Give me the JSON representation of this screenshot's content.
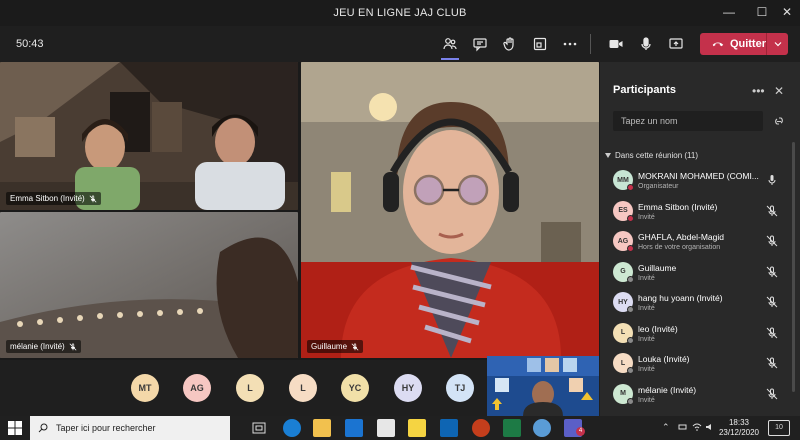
{
  "window": {
    "title": "JEU EN LIGNE JAJ CLUB",
    "minimize_glyph": "—",
    "maximize_glyph": "☐",
    "close_glyph": "✕"
  },
  "toolbar": {
    "timer": "50:43",
    "leave_label": "Quitter",
    "icons": [
      "people-icon",
      "chat-icon",
      "raise-hand-icon",
      "breakout-icon",
      "more-icon",
      "camera-icon",
      "microphone-icon",
      "share-screen-icon",
      "phone-icon"
    ]
  },
  "stage": {
    "tiles": [
      {
        "label": "Emma Sitbon (Invité)"
      },
      {
        "label": "mélanie (Invité)"
      },
      {
        "label": "Guillaume"
      }
    ],
    "avatars": [
      {
        "initials": "MT",
        "color": "#f4d8a9"
      },
      {
        "initials": "AG",
        "color": "#f6c7c2"
      },
      {
        "initials": "L",
        "color": "#f3dfb5"
      },
      {
        "initials": "L",
        "color": "#f6dcc4"
      },
      {
        "initials": "YC",
        "color": "#f1e0a8"
      },
      {
        "initials": "HY",
        "color": "#dcdcf2"
      },
      {
        "initials": "TJ",
        "color": "#d3e3f6"
      }
    ]
  },
  "panel": {
    "title": "Participants",
    "more_glyph": "•••",
    "close_glyph": "✕",
    "search_placeholder": "Tapez un nom",
    "section_label": "Dans cette réunion (11)",
    "participants": [
      {
        "initials": "MM",
        "name": "MOKRANI MOHAMED (COMI...",
        "role": "Organisateur",
        "avatar_color": "#c7e5d4",
        "status_color": "#c4314b",
        "mic": "on"
      },
      {
        "initials": "ES",
        "name": "Emma Sitbon (Invité)",
        "role": "Invité",
        "avatar_color": "#f6c7c2",
        "status_color": "#c4314b",
        "mic": "off"
      },
      {
        "initials": "AG",
        "name": "GHAFLA, Abdel-Magid",
        "role": "Hors de votre organisation",
        "avatar_color": "#f6c7c2",
        "status_color": "#c4314b",
        "mic": "off"
      },
      {
        "initials": "G",
        "name": "Guillaume",
        "role": "Invité",
        "avatar_color": "#cde8d2",
        "status_color": "#8a8a8a",
        "mic": "off"
      },
      {
        "initials": "HY",
        "name": "hang hu yoann (Invité)",
        "role": "Invité",
        "avatar_color": "#dcdcf2",
        "status_color": "#8a8a8a",
        "mic": "off"
      },
      {
        "initials": "L",
        "name": "leo (Invité)",
        "role": "Invité",
        "avatar_color": "#f3dfb5",
        "status_color": "#8a8a8a",
        "mic": "off"
      },
      {
        "initials": "L",
        "name": "Louka (Invité)",
        "role": "Invité",
        "avatar_color": "#f6dcc4",
        "status_color": "#8a8a8a",
        "mic": "off"
      },
      {
        "initials": "M",
        "name": "mélanie (Invité)",
        "role": "Invité",
        "avatar_color": "#cde8d2",
        "status_color": "#8a8a8a",
        "mic": "off"
      }
    ]
  },
  "taskbar": {
    "search_placeholder": "Taper ici pour rechercher",
    "time": "18:33",
    "date": "23/12/2020",
    "notification_count": "10",
    "teams_badge": "4",
    "apps": [
      "task-view-icon",
      "edge-icon",
      "file-explorer-icon",
      "mail-icon",
      "store-icon",
      "sticky-notes-icon",
      "outlook-icon",
      "powerpoint-icon",
      "excel-icon",
      "browser-icon",
      "teams-icon"
    ]
  }
}
